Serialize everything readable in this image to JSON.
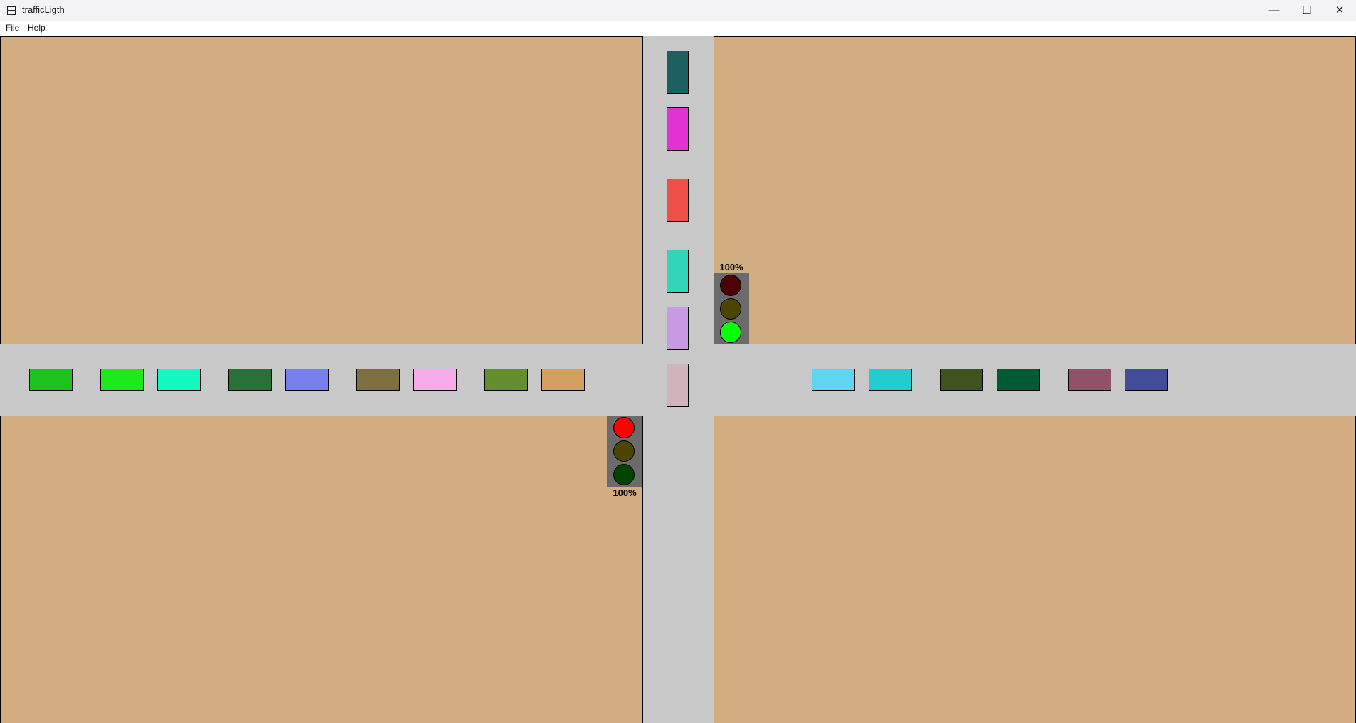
{
  "window": {
    "title": "trafficLigth",
    "minimize_glyph": "—",
    "maximize_glyph": "☐",
    "close_glyph": "✕"
  },
  "menu": {
    "items": [
      {
        "label": "File"
      },
      {
        "label": "Help"
      }
    ]
  },
  "colors": {
    "ground": "#d3ad82",
    "road": "#c8c8c8",
    "light_housing": "#6b6b6b"
  },
  "traffic_lights": {
    "north": {
      "percent": "100%",
      "red": "#4b0303",
      "yellow": "#4d4400",
      "green": "#0aff0a",
      "active": "green"
    },
    "west": {
      "percent": "100%",
      "red": "#ff0000",
      "yellow": "#4d4400",
      "green": "#004400",
      "active": "red"
    }
  },
  "cars": {
    "horizontal_west": [
      "#1fc11f",
      "#1de91d",
      "#11f8c2",
      "#2b7137",
      "#7580ed",
      "#7e6f40",
      "#f6aaea",
      "#638f31",
      "#d2a15f"
    ],
    "horizontal_east": [
      "#5fd5f2",
      "#23cdcd",
      "#3e531e",
      "#005a33",
      "#905268",
      "#424c97"
    ],
    "vertical_north": [
      "#1e5f62",
      "#e232d4",
      "#ee5049",
      "#31d5b7",
      "#c89ae2",
      "#cfb4bb"
    ]
  }
}
